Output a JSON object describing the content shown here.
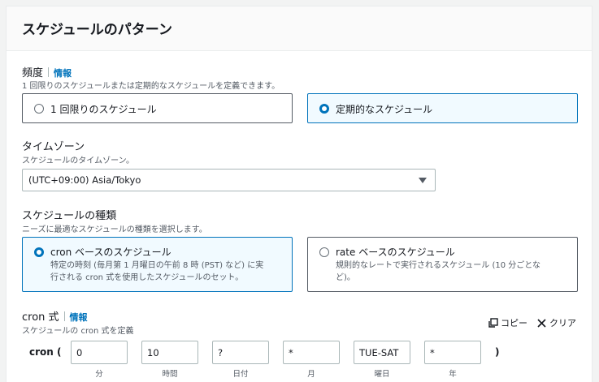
{
  "panel": {
    "title": "スケジュールのパターン"
  },
  "frequency": {
    "label": "頻度",
    "info": "情報",
    "description": "1 回限りのスケジュールまたは定期的なスケジュールを定義できます。",
    "options": [
      {
        "label": "1 回限りのスケジュール",
        "selected": false
      },
      {
        "label": "定期的なスケジュール",
        "selected": true
      }
    ]
  },
  "timezone": {
    "label": "タイムゾーン",
    "description": "スケジュールのタイムゾーン。",
    "value": "(UTC+09:00) Asia/Tokyo"
  },
  "schedule_type": {
    "label": "スケジュールの種類",
    "description": "ニーズに最適なスケジュールの種類を選択します。",
    "options": [
      {
        "label": "cron ベースのスケジュール",
        "desc_line1": "特定の時刻 (毎月第 1 月曜日の午前 8 時 (PST) など) に実",
        "desc_line2": "行される cron 式を使用したスケジュールのセット。",
        "selected": true
      },
      {
        "label": "rate ベースのスケジュール",
        "desc_line1": "規則的なレートで実行されるスケジュール (10 分ごとな",
        "desc_line2": "ど)。",
        "selected": false
      }
    ]
  },
  "cron": {
    "label": "cron 式",
    "info": "情報",
    "description": "スケジュールの cron 式を定義",
    "copy_label": "コピー",
    "clear_label": "クリア",
    "open": "cron (",
    "close": ")",
    "fields": [
      {
        "value": "0",
        "caption": "分"
      },
      {
        "value": "10",
        "caption": "時間"
      },
      {
        "value": "?",
        "caption": "日付"
      },
      {
        "value": "*",
        "caption": "月"
      },
      {
        "value": "TUE-SAT",
        "caption": "曜日"
      },
      {
        "value": "*",
        "caption": "年"
      }
    ]
  },
  "colors": {
    "accent": "#0073bb",
    "selected_bg": "#f1faff",
    "border": "#545b64"
  },
  "icons": {
    "copy": "copy-icon",
    "clear": "close-icon",
    "dropdown": "caret-down-icon"
  }
}
